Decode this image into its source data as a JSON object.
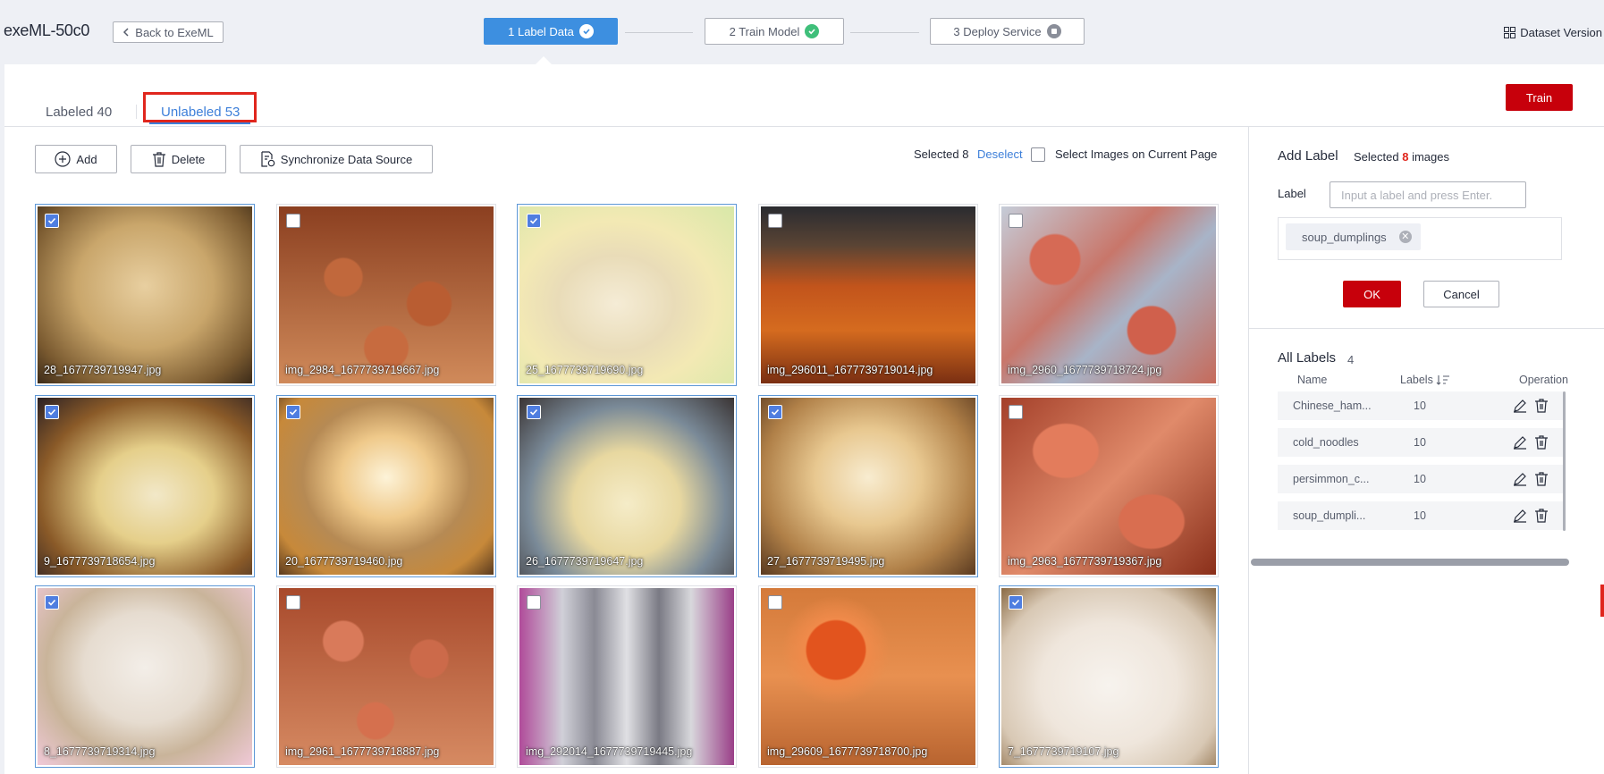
{
  "header": {
    "app_title": "exeML-50c0",
    "back_label": "Back to ExeML",
    "steps": [
      {
        "label": "1 Label Data",
        "status": "current"
      },
      {
        "label": "2 Train Model",
        "status": "done"
      },
      {
        "label": "3 Deploy Service",
        "status": "stopped"
      }
    ],
    "dataset_version_label": "Dataset Version"
  },
  "tabs": {
    "labeled": "Labeled 40",
    "unlabeled": "Unlabeled 53",
    "active": "unlabeled"
  },
  "train_label": "Train",
  "toolbar": {
    "add_label": "Add",
    "delete_label": "Delete",
    "sync_label": "Synchronize Data Source",
    "selected_text": "Selected 8",
    "deselect_label": "Deselect",
    "select_page_label": "Select Images on Current Page"
  },
  "images": [
    {
      "name": "28_1677739719947.jpg",
      "selected": true
    },
    {
      "name": "img_2984_1677739719667.jpg",
      "selected": false
    },
    {
      "name": "25_1677739719690.jpg",
      "selected": true
    },
    {
      "name": "img_296011_1677739719014.jpg",
      "selected": false
    },
    {
      "name": "img_2960_1677739718724.jpg",
      "selected": false
    },
    {
      "name": "9_1677739718654.jpg",
      "selected": true
    },
    {
      "name": "20_1677739719460.jpg",
      "selected": true
    },
    {
      "name": "26_1677739719647.jpg",
      "selected": true
    },
    {
      "name": "27_1677739719495.jpg",
      "selected": true
    },
    {
      "name": "img_2963_1677739719367.jpg",
      "selected": false
    },
    {
      "name": "8_1677739719314.jpg",
      "selected": true
    },
    {
      "name": "img_2961_1677739718887.jpg",
      "selected": false
    },
    {
      "name": "img_292014_1677739719445.jpg",
      "selected": false
    },
    {
      "name": "img_29609_1677739718700.jpg",
      "selected": false
    },
    {
      "name": "7_1677739719107.jpg",
      "selected": true
    }
  ],
  "add_label_panel": {
    "title": "Add Label",
    "selected_prefix": "Selected",
    "selected_count": "8",
    "selected_suffix": "images",
    "label_field": "Label",
    "input_placeholder": "Input a label and press Enter.",
    "input_value": "",
    "tag": "soup_dumplings",
    "ok_label": "OK",
    "cancel_label": "Cancel"
  },
  "all_labels": {
    "title": "All Labels",
    "count": "4",
    "columns": {
      "name": "Name",
      "labels": "Labels",
      "operation": "Operation"
    },
    "rows": [
      {
        "name": "Chinese_ham...",
        "count": "10"
      },
      {
        "name": "cold_noodles",
        "count": "10"
      },
      {
        "name": "persimmon_c...",
        "count": "10"
      },
      {
        "name": "soup_dumpli...",
        "count": "10"
      }
    ]
  },
  "colors": {
    "accent_blue": "#3d8fe0",
    "primary_red": "#c7000b",
    "highlight_red": "#e0261d",
    "success_green": "#3fbf7a"
  },
  "icons": [
    "chevron-left-icon",
    "check-circle-icon",
    "stop-circle-icon",
    "grid-icon",
    "plus-circle-icon",
    "trash-icon",
    "sync-icon",
    "close-circle-icon",
    "pencil-icon",
    "sort-icon",
    "checkmark-icon"
  ]
}
